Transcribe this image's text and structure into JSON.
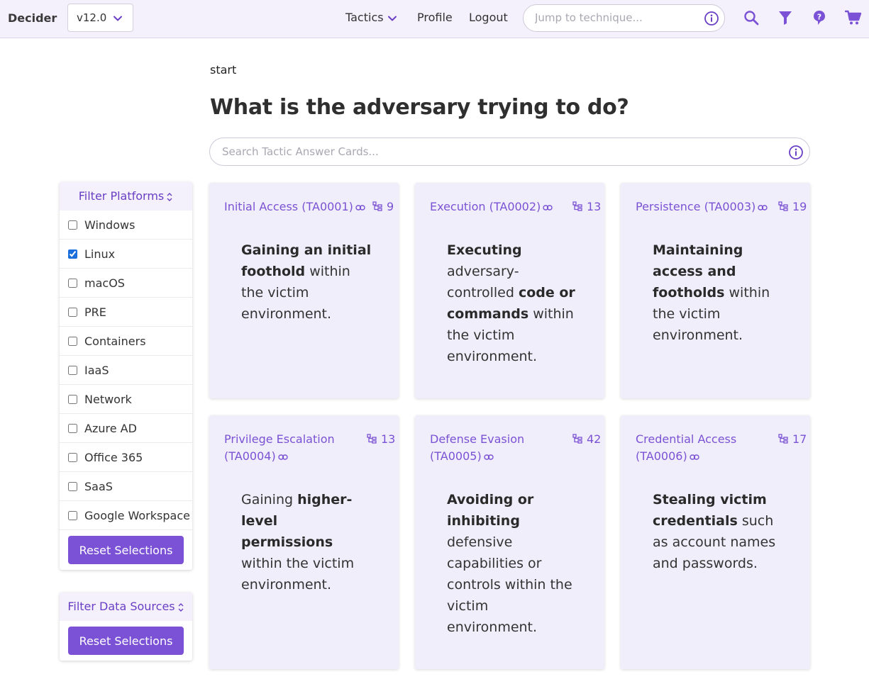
{
  "navbar": {
    "brand": "Decider",
    "version": "v12.0",
    "links": {
      "tactics": "Tactics",
      "profile": "Profile",
      "logout": "Logout"
    },
    "jump_placeholder": "Jump to technique..."
  },
  "page": {
    "breadcrumb": "start",
    "heading": "What is the adversary trying to do?",
    "search_placeholder": "Search Tactic Answer Cards..."
  },
  "filters": {
    "platforms_title": "Filter Platforms",
    "platforms": [
      {
        "label": "Windows",
        "checked": false
      },
      {
        "label": "Linux",
        "checked": true
      },
      {
        "label": "macOS",
        "checked": false
      },
      {
        "label": "PRE",
        "checked": false
      },
      {
        "label": "Containers",
        "checked": false
      },
      {
        "label": "IaaS",
        "checked": false
      },
      {
        "label": "Network",
        "checked": false
      },
      {
        "label": "Azure AD",
        "checked": false
      },
      {
        "label": "Office 365",
        "checked": false
      },
      {
        "label": "SaaS",
        "checked": false
      },
      {
        "label": "Google Workspace",
        "checked": false
      }
    ],
    "reset_label": "Reset Selections",
    "datasources_title": "Filter Data Sources",
    "reset_label_2": "Reset Selections"
  },
  "cards": [
    {
      "name": "Initial Access (TA0001)",
      "count": "9",
      "desc": [
        {
          "b": true,
          "t": "Gaining an initial foothold"
        },
        {
          "b": false,
          "t": " within the victim environment."
        }
      ]
    },
    {
      "name": "Execution (TA0002)",
      "count": "13",
      "desc": [
        {
          "b": true,
          "t": "Executing"
        },
        {
          "b": false,
          "t": " adversary-controlled "
        },
        {
          "b": true,
          "t": "code or commands"
        },
        {
          "b": false,
          "t": " within the victim environment."
        }
      ]
    },
    {
      "name": "Persistence (TA0003)",
      "count": "19",
      "desc": [
        {
          "b": true,
          "t": "Maintaining access and footholds"
        },
        {
          "b": false,
          "t": " within the victim environment."
        }
      ]
    },
    {
      "name": "Privilege Escalation (TA0004)",
      "count": "13",
      "desc": [
        {
          "b": false,
          "t": "Gaining "
        },
        {
          "b": true,
          "t": "higher-level permissions"
        },
        {
          "b": false,
          "t": " within the victim environment."
        }
      ]
    },
    {
      "name": "Defense Evasion (TA0005)",
      "count": "42",
      "desc": [
        {
          "b": true,
          "t": "Avoiding or inhibiting"
        },
        {
          "b": false,
          "t": " defensive capabilities or controls within the victim environment."
        }
      ]
    },
    {
      "name": "Credential Access (TA0006)",
      "count": "17",
      "desc": [
        {
          "b": true,
          "t": "Stealing victim credentials"
        },
        {
          "b": false,
          "t": " such as account names and passwords."
        }
      ]
    }
  ],
  "colors": {
    "accent": "#7b52d6",
    "card_bg": "#f1eefb",
    "nav_bg": "#f4f1fc"
  }
}
